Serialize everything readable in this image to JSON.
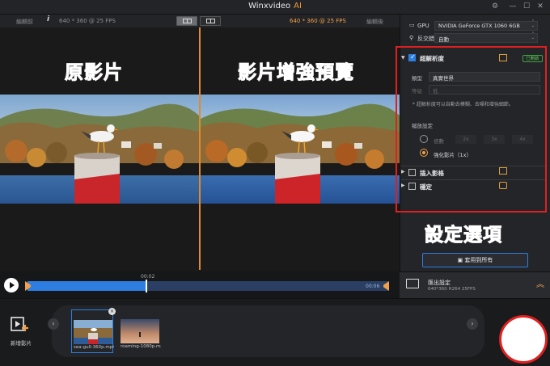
{
  "window": {
    "title": "Winxvideo",
    "title_ai": "AI",
    "settings_glyph": "⚙",
    "min_glyph": "—",
    "max_glyph": "☐",
    "close_glyph": "✕"
  },
  "video_header": {
    "left_label": "編輯前",
    "info_glyph": "i",
    "left_res": "640 * 360 @ 25 FPS",
    "right_res": "640 * 360 @ 25 FPS",
    "right_label": "編輯後"
  },
  "annotations": {
    "original": "原影片",
    "enhanced": "影片增強預覽",
    "settings": "設定選項"
  },
  "timeline": {
    "current": "00:02",
    "end": "00:06",
    "progress": 0.33
  },
  "panel": {
    "gpu_label": "GPU",
    "gpu_value": "NVIDIA GeForce GTX 1060 6GB",
    "deinterlace_label": "反交錯",
    "deinterlace_value": "自動",
    "superres": {
      "label": "超解析度",
      "status": "已開啟",
      "type_label": "類型",
      "type_value": "真實世界",
      "level_label": "等級",
      "level_value": "低",
      "note": "* 超解析度可以自動去模糊、去噪和增強細節。",
      "scale_label": "縮放設定",
      "option_multiple": "倍數",
      "scale_options": [
        "2x",
        "3x",
        "4x"
      ],
      "option_enhance": "強化影片（1x）"
    },
    "insert_label": "插入影格",
    "stabilize_label": "穩定",
    "apply_all": "套用到所有"
  },
  "export": {
    "title": "匯出設定",
    "details": "640*360  H264  25FPS"
  },
  "library": {
    "add_label": "新增影片",
    "prev_glyph": "‹",
    "next_glyph": "›",
    "remove_glyph": "×",
    "items": [
      {
        "name": "sea-gull-360p.mp4"
      },
      {
        "name": "roaming-1080p.mp4"
      }
    ]
  },
  "colors": {
    "accent_orange": "#f0a14a",
    "accent_blue": "#2d7fe1",
    "annotation_red": "#e02020"
  }
}
